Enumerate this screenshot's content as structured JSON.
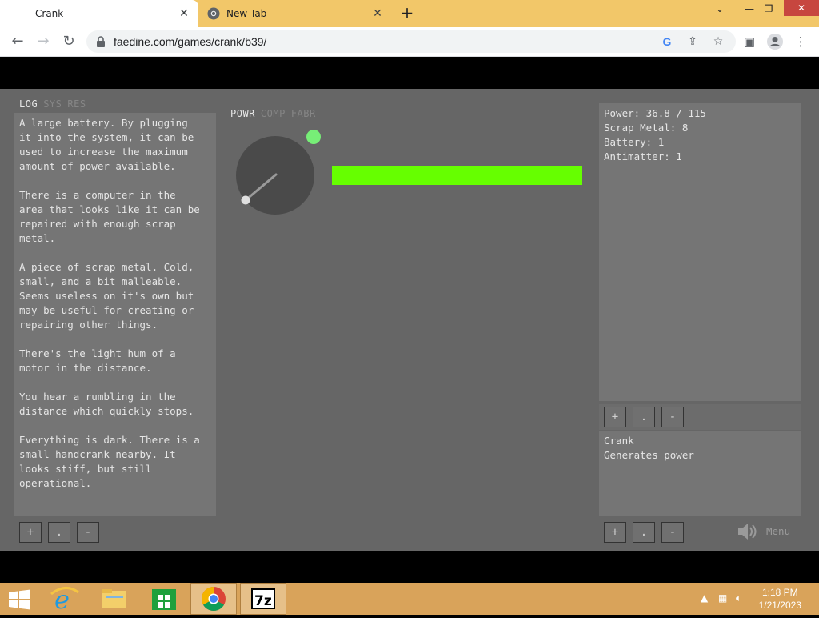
{
  "browser": {
    "tabs": [
      {
        "title": "Crank",
        "active": true
      },
      {
        "title": "New Tab",
        "active": false
      }
    ],
    "url": "faedine.com/games/crank/b39/"
  },
  "game": {
    "log_tabs": [
      "LOG",
      "SYS",
      "RES"
    ],
    "log_active": "LOG",
    "log_text": "A large battery. By plugging\nit into the system, it can be\nused to increase the maximum\namount of power available.\n\nThere is a computer in the\narea that looks like it can be\nrepaired with enough scrap\nmetal.\n\nA piece of scrap metal. Cold,\nsmall, and a bit malleable.\nSeems useless on it's own but\nmay be useful for creating or\nrepairing other things.\n\nThere's the light hum of a\nmotor in the distance.\n\nYou hear a rumbling in the\ndistance which quickly stops.\n\nEverything is dark. There is a\nsmall handcrank nearby. It\nlooks stiff, but still\noperational.",
    "main_tabs": [
      "POWR",
      "COMP",
      "FABR"
    ],
    "main_active": "POWR",
    "power_bar_fill": 1.0,
    "power_bar_color": "#66ff00",
    "indicator_color": "#77ee77",
    "stats": {
      "power": "Power: 36.8 / 115",
      "scrap": "Scrap Metal: 8",
      "battery": "Battery: 1",
      "antimatter": "Antimatter: 1"
    },
    "info": {
      "title": "Crank",
      "desc": "Generates power"
    },
    "buttons": {
      "plus": "+",
      "dot": ".",
      "minus": "-"
    },
    "menu_label": "Menu",
    "speaker_icon": "speaker-icon"
  },
  "taskbar": {
    "time": "1:18 PM",
    "date": "1/21/2023"
  }
}
